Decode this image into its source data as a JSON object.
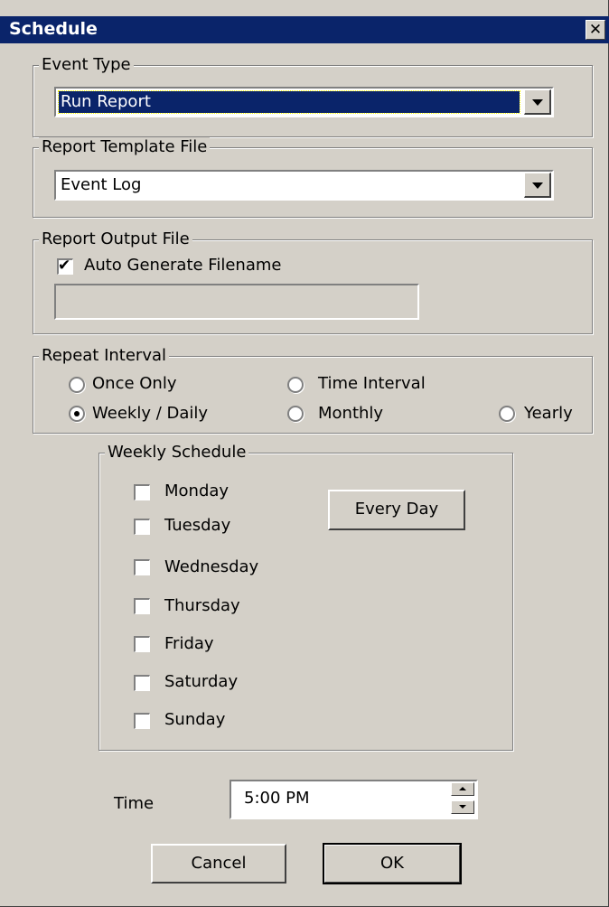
{
  "window": {
    "title": "Schedule",
    "close_glyph": "✕"
  },
  "event_type": {
    "legend": "Event Type",
    "selected": "Run Report"
  },
  "report_template": {
    "legend": "Report Template File",
    "selected": "Event Log"
  },
  "report_output": {
    "legend": "Report Output File",
    "auto_generate_label": "Auto Generate Filename",
    "auto_generate_checked": true,
    "filename": ""
  },
  "repeat_interval": {
    "legend": "Repeat Interval",
    "options": [
      {
        "label": "Once Only",
        "selected": false
      },
      {
        "label": "Time Interval",
        "selected": false
      },
      {
        "label": "Weekly / Daily",
        "selected": true
      },
      {
        "label": "Monthly",
        "selected": false
      },
      {
        "label": "Yearly",
        "selected": false
      }
    ]
  },
  "weekly_schedule": {
    "legend": "Weekly Schedule",
    "days": [
      {
        "label": "Monday",
        "checked": false
      },
      {
        "label": "Tuesday",
        "checked": false
      },
      {
        "label": "Wednesday",
        "checked": false
      },
      {
        "label": "Thursday",
        "checked": false
      },
      {
        "label": "Friday",
        "checked": false
      },
      {
        "label": "Saturday",
        "checked": false
      },
      {
        "label": "Sunday",
        "checked": false
      }
    ],
    "every_day_label": "Every Day"
  },
  "time": {
    "label": "Time",
    "value": "5:00 PM"
  },
  "buttons": {
    "cancel": "Cancel",
    "ok": "OK"
  },
  "icons": {
    "check_glyph": "✔",
    "close": "close-icon",
    "dropdown": "chevron-down-icon"
  },
  "colors": {
    "title_bar": "#0a246a",
    "face": "#d4d0c8",
    "selection": "#0a246a"
  }
}
